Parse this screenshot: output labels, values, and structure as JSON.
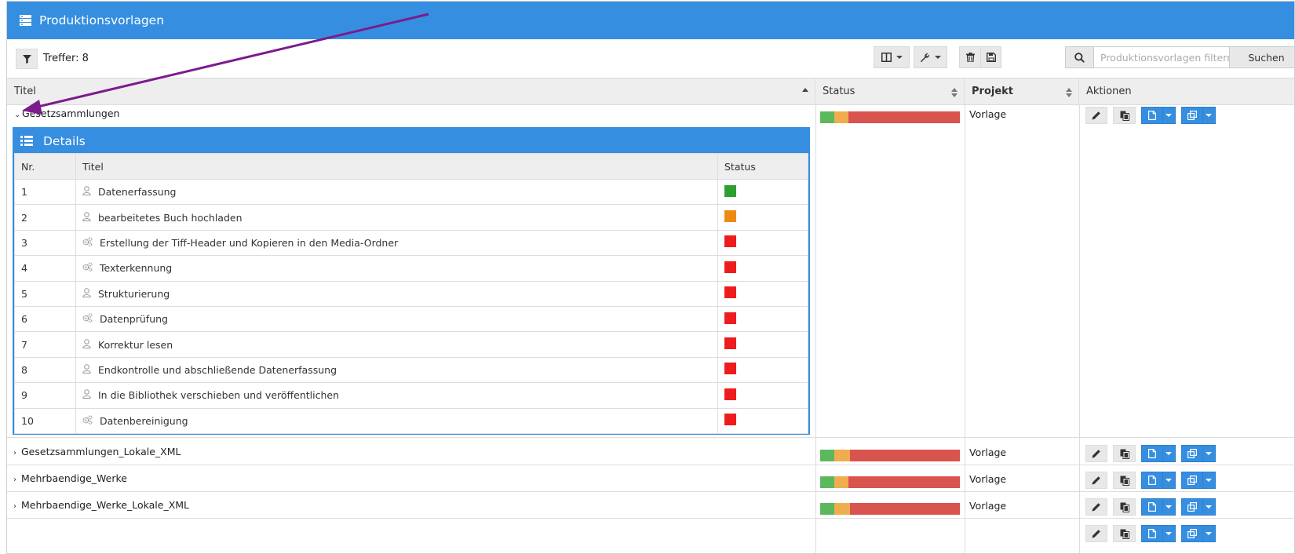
{
  "header": {
    "title": "Produktionsvorlagen",
    "icon": "list-stack-icon"
  },
  "toolbar": {
    "hits_label": "Treffer: 8",
    "search": {
      "placeholder": "Produktionsvorlagen filtern",
      "value": "",
      "button_label": "Suchen"
    }
  },
  "columns": {
    "title": "Titel",
    "status": "Status",
    "project": "Projekt",
    "actions": "Aktionen"
  },
  "colors": {
    "accent": "#368ee0",
    "status_done": "#5cb85c",
    "status_open": "#f0ad4e",
    "status_locked": "#d9534f",
    "task_done": "#2e9e2e",
    "task_open": "#ee8a12",
    "task_locked": "#ee1c1c",
    "annotation_arrow": "#7b1b8c"
  },
  "rows": [
    {
      "title": "Gesetzsammlungen",
      "expanded": true,
      "project": "Vorlage",
      "status": {
        "done": 0.1,
        "open": 0.1,
        "locked": 0.8
      }
    },
    {
      "title": "Gesetzsammlungen_Lokale_XML",
      "expanded": false,
      "project": "Vorlage",
      "status": {
        "done": 0.1,
        "open": 0.11,
        "locked": 0.79
      }
    },
    {
      "title": "Mehrbaendige_Werke",
      "expanded": false,
      "project": "Vorlage",
      "status": {
        "done": 0.1,
        "open": 0.1,
        "locked": 0.8
      }
    },
    {
      "title": "Mehrbaendige_Werke_Lokale_XML",
      "expanded": false,
      "project": "Vorlage",
      "status": {
        "done": 0.1,
        "open": 0.11,
        "locked": 0.79
      }
    }
  ],
  "details": {
    "title": "Details",
    "headers": {
      "nr": "Nr.",
      "title": "Titel",
      "status": "Status"
    },
    "tasks": [
      {
        "nr": "1",
        "title": "Datenerfassung",
        "type": "user-icon",
        "status": "task_done"
      },
      {
        "nr": "2",
        "title": "bearbeitetes Buch hochladen",
        "type": "user-icon",
        "status": "task_open"
      },
      {
        "nr": "3",
        "title": "Erstellung der Tiff-Header und Kopieren in den Media-Ordner",
        "type": "gears-icon",
        "status": "task_locked"
      },
      {
        "nr": "4",
        "title": "Texterkennung",
        "type": "gears-icon",
        "status": "task_locked"
      },
      {
        "nr": "5",
        "title": "Strukturierung",
        "type": "user-icon",
        "status": "task_locked"
      },
      {
        "nr": "6",
        "title": "Datenprüfung",
        "type": "gears-icon",
        "status": "task_locked"
      },
      {
        "nr": "7",
        "title": "Korrektur lesen",
        "type": "user-icon",
        "status": "task_locked"
      },
      {
        "nr": "8",
        "title": "Endkontrolle und abschließende Datenerfassung",
        "type": "user-icon",
        "status": "task_locked"
      },
      {
        "nr": "9",
        "title": "In die Bibliothek verschieben und veröffentlichen",
        "type": "user-icon",
        "status": "task_locked"
      },
      {
        "nr": "10",
        "title": "Datenbereinigung",
        "type": "gears-icon",
        "status": "task_locked"
      }
    ]
  }
}
